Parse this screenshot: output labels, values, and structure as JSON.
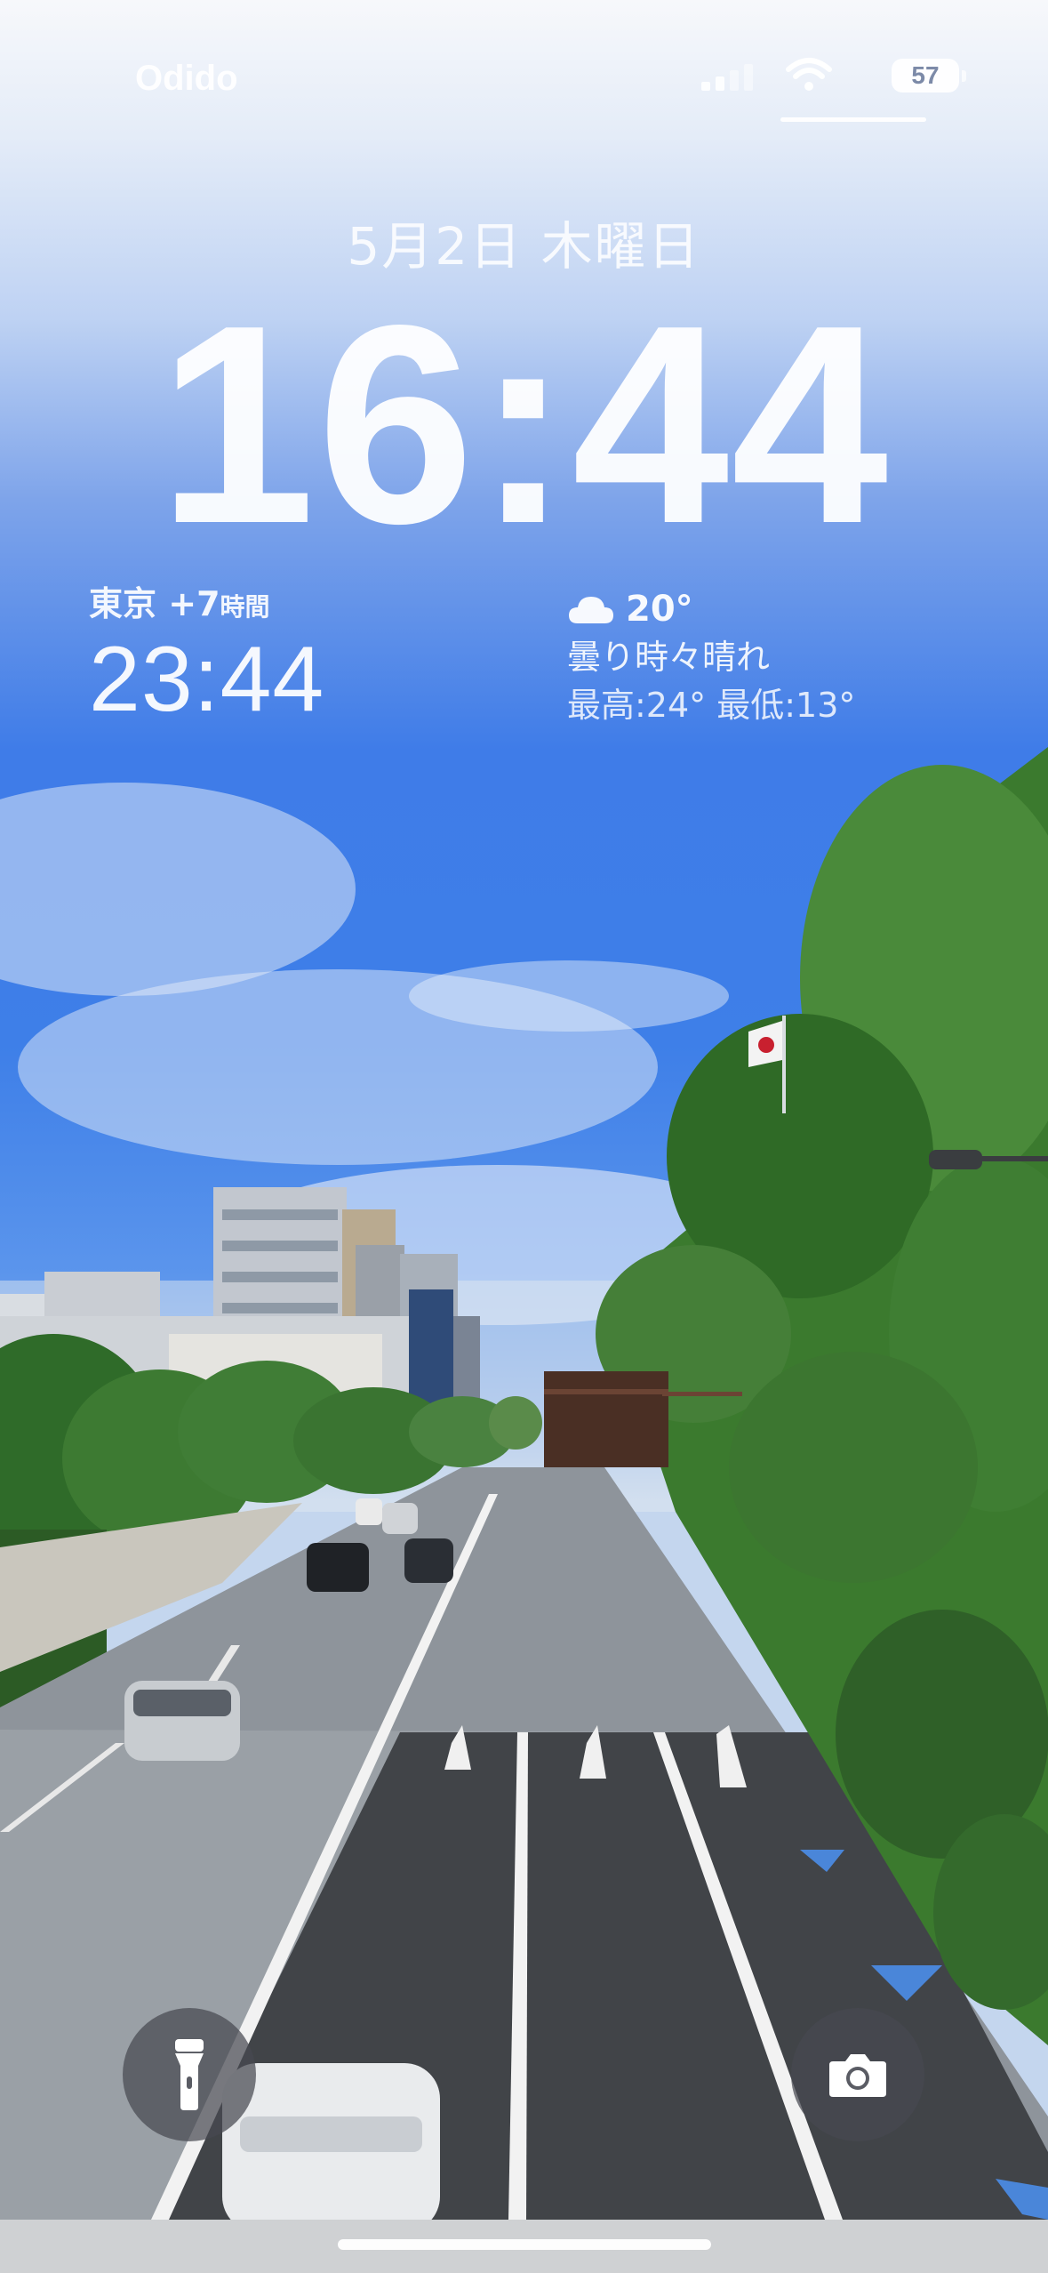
{
  "status_bar": {
    "carrier": "Odido",
    "battery_level": "57",
    "icons": [
      "signal-icon",
      "wifi-icon",
      "battery-icon"
    ]
  },
  "lock_screen": {
    "date": "5月2日 木曜日",
    "time": "16:44"
  },
  "world_clock": {
    "city": "東京",
    "offset": "+7",
    "offset_unit": "時間",
    "time": "23:44"
  },
  "weather": {
    "icon": "cloud-icon",
    "temperature": "20°",
    "condition": "曇り時々晴れ",
    "range": "最高:24° 最低:13°"
  },
  "controls": {
    "left": "flashlight-icon",
    "right": "camera-icon"
  },
  "colors": {
    "sky_top": "#f7f8fb",
    "sky_mid": "#3e7fe8",
    "road": "#8d949c",
    "trees": "#3f7d33"
  }
}
